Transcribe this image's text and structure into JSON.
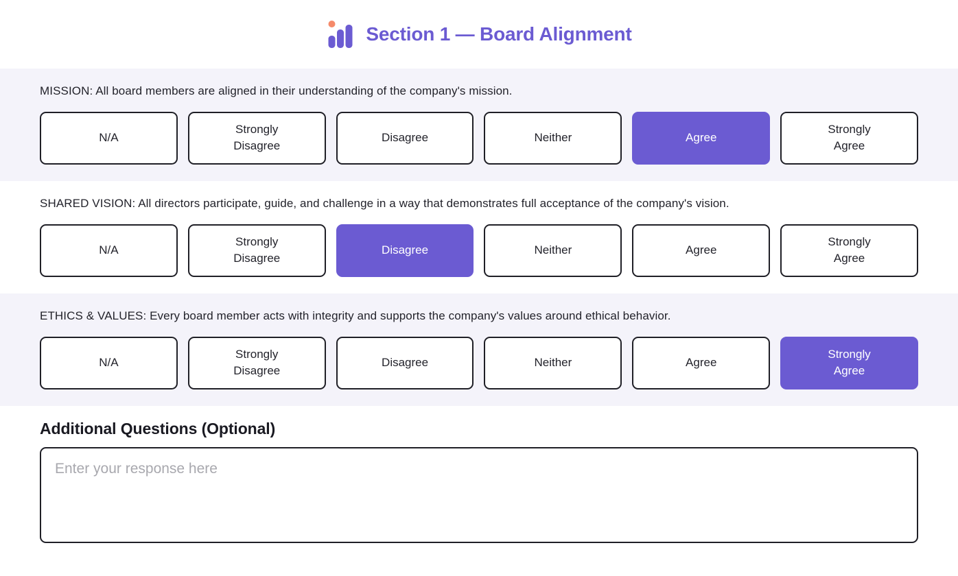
{
  "header": {
    "title": "Section 1 — Board Alignment",
    "logo_icon": "bar-chart-icon",
    "accent_color": "#6B5BD2",
    "logo_dot_color": "#F58A6A"
  },
  "questions": [
    {
      "text": "MISSION: All board members are aligned in their understanding of the company's mission.",
      "options": [
        "N/A",
        "Strongly\nDisagree",
        "Disagree",
        "Neither",
        "Agree",
        "Strongly\nAgree"
      ],
      "selected_index": 4,
      "selected_label": "Agree",
      "band_style": "shaded"
    },
    {
      "text": "SHARED VISION: All directors participate, guide, and challenge in a way that demonstrates full acceptance of the company's vision.",
      "options": [
        "N/A",
        "Strongly\nDisagree",
        "Disagree",
        "Neither",
        "Agree",
        "Strongly\nAgree"
      ],
      "selected_index": 2,
      "selected_label": "Disagree",
      "band_style": "plain"
    },
    {
      "text": "ETHICS & VALUES: Every board member acts with integrity and supports the company's values around ethical behavior.",
      "options": [
        "N/A",
        "Strongly\nDisagree",
        "Disagree",
        "Neither",
        "Agree",
        "Strongly\nAgree"
      ],
      "selected_index": 5,
      "selected_label": "Strongly Agree",
      "band_style": "shaded"
    }
  ],
  "footer": {
    "title": "Additional Questions (Optional)",
    "response_placeholder": "Enter your response here",
    "response_value": ""
  }
}
